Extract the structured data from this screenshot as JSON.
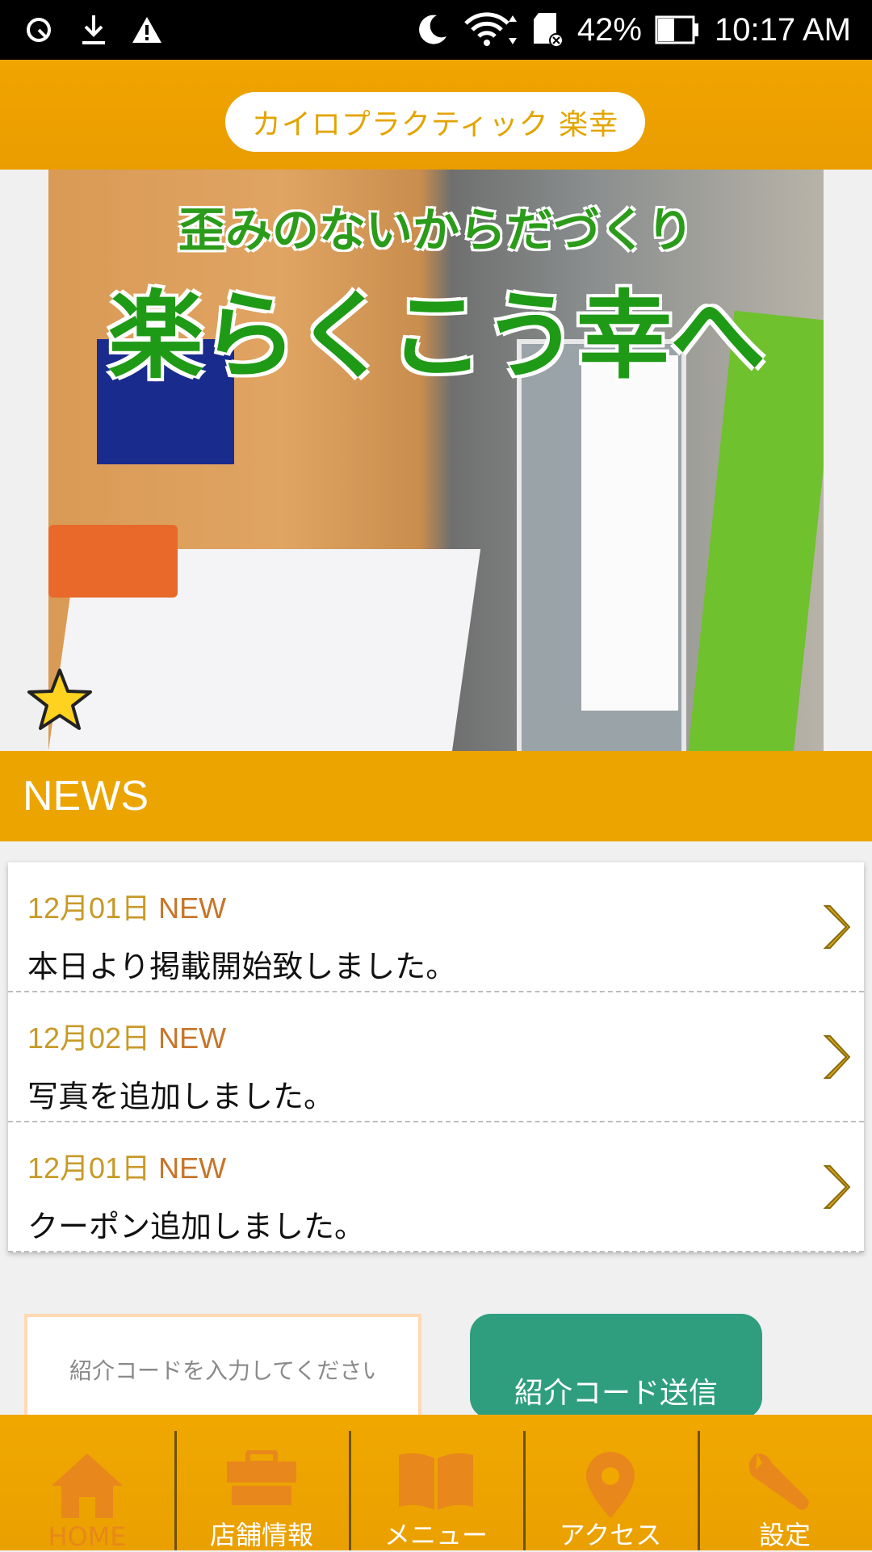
{
  "status_bar": {
    "battery": "42%",
    "time": "10:17 AM",
    "icons_left": [
      "sync-icon",
      "download-icon",
      "warning-icon"
    ],
    "icons_right": [
      "moon-icon",
      "wifi-icon",
      "sd-card-icon",
      "battery-icon"
    ]
  },
  "header": {
    "title": "カイロプラクティック 楽幸"
  },
  "hero": {
    "line1": "歪みのないからだづくり",
    "line2": "楽らくこう幸へ"
  },
  "news": {
    "title": "NEWS",
    "items": [
      {
        "date": "12月01日",
        "badge": "NEW",
        "text": "本日より掲載開始致しました。"
      },
      {
        "date": "12月02日",
        "badge": "NEW",
        "text": "写真を追加しました。"
      },
      {
        "date": "12月01日",
        "badge": "NEW",
        "text": "クーポン追加しました。"
      }
    ]
  },
  "referral": {
    "placeholder": "紹介コードを入力してください",
    "button_label": "紹介コード送信"
  },
  "bottom_nav": {
    "items": [
      {
        "label": "HOME",
        "icon": "home-icon",
        "active": true
      },
      {
        "label": "店舗情報",
        "icon": "shop-icon"
      },
      {
        "label": "メニュー",
        "icon": "book-icon"
      },
      {
        "label": "アクセス",
        "icon": "map-pin-icon"
      },
      {
        "label": "設定",
        "icon": "wrench-icon"
      }
    ]
  },
  "colors": {
    "accent": "#eba400",
    "button": "#2f9e7e",
    "date": "#c79a28"
  }
}
